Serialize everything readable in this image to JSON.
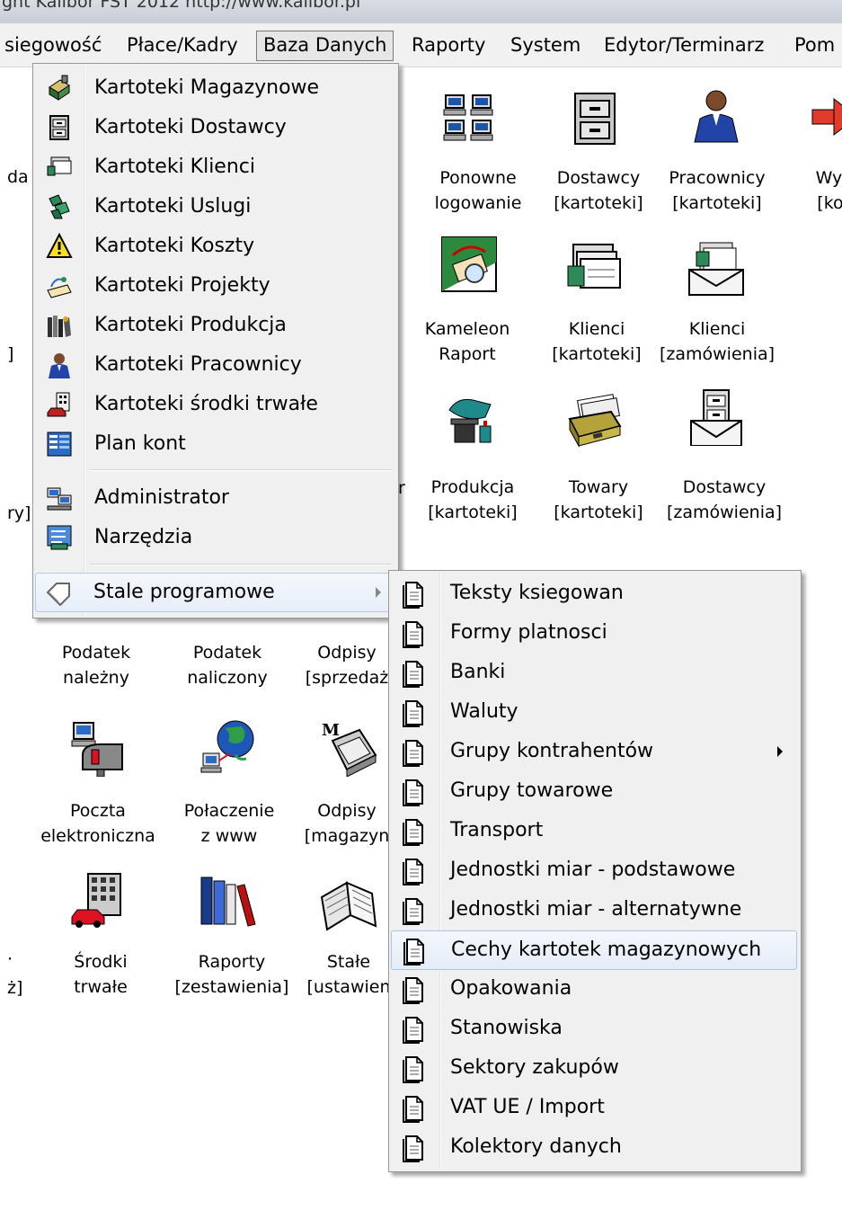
{
  "window": {
    "title_fragment": "ght Kalibor FST 2012 http://www.kalibor.pl"
  },
  "menubar": {
    "items": [
      {
        "label": "siegowość"
      },
      {
        "label": "Płace/Kadry"
      },
      {
        "label": "Baza Danych",
        "active": true
      },
      {
        "label": "Raporty"
      },
      {
        "label": "System"
      },
      {
        "label": "Edytor/Terminarz"
      },
      {
        "label": "Pom"
      }
    ]
  },
  "desktop": {
    "icons": [
      {
        "line1": "Ponowne",
        "line2": "logowanie",
        "icon": "computers-icon"
      },
      {
        "line1": "Dostawcy",
        "line2": "[kartoteki]",
        "icon": "cabinet-icon"
      },
      {
        "line1": "Pracownicy",
        "line2": "[kartoteki]",
        "icon": "worker-icon"
      },
      {
        "line1": "Wyjś",
        "line2": "[kon",
        "icon": "exit-icon"
      },
      {
        "line1": "Kameleon",
        "line2": "Raport",
        "icon": "report-icon"
      },
      {
        "line1": "Klienci",
        "line2": "[kartoteki]",
        "icon": "card-files-icon"
      },
      {
        "line1": "Klienci",
        "line2": "[zamówienia]",
        "icon": "envelope-files-icon"
      },
      {
        "line1": "Produkcja",
        "line2": "[kartoteki]",
        "icon": "factory-icon"
      },
      {
        "line1": "Towary",
        "line2": "[kartoteki]",
        "icon": "card-box-icon"
      },
      {
        "line1": "Dostawcy",
        "line2": "[zamówienia]",
        "icon": "envelope-cabinet-icon"
      },
      {
        "line1": "Podatek",
        "line2": "należny",
        "icon": ""
      },
      {
        "line1": "Podatek",
        "line2": "naliczony",
        "icon": ""
      },
      {
        "line1": "Odpisy",
        "line2": "[sprzedaż",
        "icon": ""
      },
      {
        "line1": "Poczta",
        "line2": "elektroniczna",
        "icon": "mail-icon"
      },
      {
        "line1": "Połaczenie",
        "line2": "z www",
        "icon": "globe-icon"
      },
      {
        "line1": "Odpisy",
        "line2": "[magazyn",
        "icon": "printer-icon"
      },
      {
        "line1": "Środki",
        "line2": "trwałe",
        "icon": "building-car-icon"
      },
      {
        "line1": "Raporty",
        "line2": "[zestawienia]",
        "icon": "books-icon"
      },
      {
        "line1": "Stałe",
        "line2": "[ustawien",
        "icon": "open-book-icon"
      }
    ],
    "fragments": [
      "da",
      "]",
      "ry]",
      "r",
      "ż]",
      "·"
    ]
  },
  "baza_menu": {
    "items": [
      {
        "label": "Kartoteki Magazynowe",
        "icon": "warehouse-icon"
      },
      {
        "label": "Kartoteki Dostawcy",
        "icon": "cabinet-icon"
      },
      {
        "label": "Kartoteki Klienci",
        "icon": "card-files-icon"
      },
      {
        "label": "Kartoteki Uslugi",
        "icon": "services-icon"
      },
      {
        "label": "Kartoteki Koszty",
        "icon": "warning-icon"
      },
      {
        "label": "Kartoteki Projekty",
        "icon": "projects-icon"
      },
      {
        "label": "Kartoteki Produkcja",
        "icon": "production-icon"
      },
      {
        "label": "Kartoteki Pracownicy",
        "icon": "worker-icon"
      },
      {
        "label": "Kartoteki środki trwałe",
        "icon": "assets-icon"
      },
      {
        "label": "Plan kont",
        "icon": "chart-of-accounts-icon"
      },
      {
        "label": "Administrator",
        "icon": "admin-icon"
      },
      {
        "label": "Narzędzia",
        "icon": "tools-icon"
      },
      {
        "label": "Stale programowe",
        "icon": "tag-icon"
      }
    ]
  },
  "stale_submenu": {
    "items": [
      {
        "label": "Teksty ksiegowan"
      },
      {
        "label": "Formy platnosci"
      },
      {
        "label": "Banki"
      },
      {
        "label": "Waluty"
      },
      {
        "label": "Grupy kontrahentów",
        "has_submenu": true
      },
      {
        "label": "Grupy towarowe"
      },
      {
        "label": "Transport"
      },
      {
        "label": "Jednostki miar - podstawowe"
      },
      {
        "label": "Jednostki miar - alternatywne"
      },
      {
        "label": "Cechy  kartotek magazynowych",
        "highlighted": true
      },
      {
        "label": "Opakowania"
      },
      {
        "label": "Stanowiska"
      },
      {
        "label": "Sektory zakupów"
      },
      {
        "label": "VAT UE / Import"
      },
      {
        "label": "Kolektory danych"
      }
    ]
  }
}
